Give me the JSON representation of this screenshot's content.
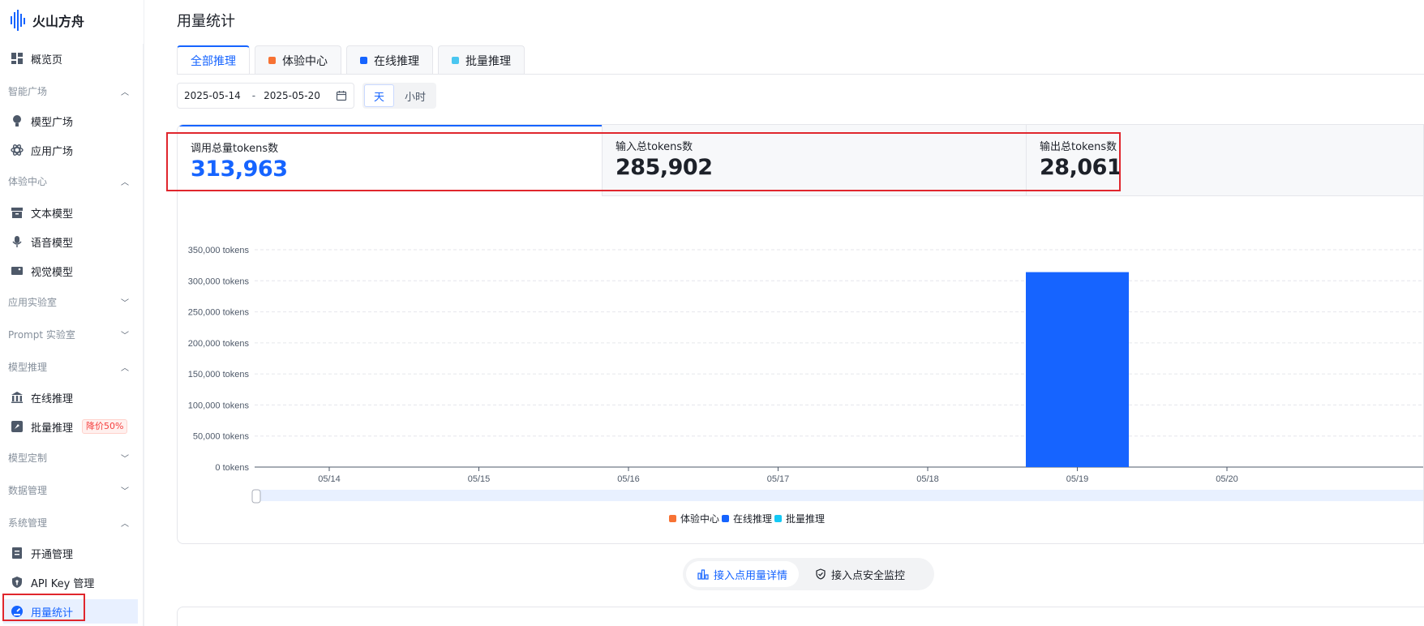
{
  "app": {
    "name": "火山方舟"
  },
  "sidebar": {
    "overview": "概览页",
    "groups": [
      {
        "title": "智能广场",
        "chevron": "up",
        "items": [
          "模型广场",
          "应用广场"
        ]
      },
      {
        "title": "体验中心",
        "chevron": "up",
        "items": [
          "文本模型",
          "语音模型",
          "视觉模型"
        ]
      },
      {
        "title": "应用实验室",
        "chevron": "down",
        "items": []
      },
      {
        "title": "Prompt 实验室",
        "chevron": "down",
        "items": []
      },
      {
        "title": "模型推理",
        "chevron": "up",
        "items": [
          "在线推理",
          "批量推理"
        ]
      },
      {
        "title": "模型定制",
        "chevron": "down",
        "items": []
      },
      {
        "title": "数据管理",
        "chevron": "down",
        "items": []
      },
      {
        "title": "系统管理",
        "chevron": "up",
        "items": [
          "开通管理",
          "API Key 管理",
          "用量统计"
        ]
      }
    ],
    "batch_badge": "降价50%"
  },
  "page": {
    "title": "用量统计",
    "tabs": [
      {
        "label": "全部推理",
        "color": null,
        "active": true
      },
      {
        "label": "体验中心",
        "color": "#f77234",
        "active": false
      },
      {
        "label": "在线推理",
        "color": "#1664ff",
        "active": false
      },
      {
        "label": "批量推理",
        "color": "#4ac6f0",
        "active": false
      }
    ],
    "date_start": "2025-05-14",
    "date_sep": "-",
    "date_end": "2025-05-20",
    "granularity": {
      "day": "天",
      "hour": "小时",
      "selected": "天"
    },
    "stats": [
      {
        "label": "调用总量tokens数",
        "value": "313,963"
      },
      {
        "label": "输入总tokens数",
        "value": "285,902"
      },
      {
        "label": "输出总tokens数",
        "value": "28,061"
      }
    ],
    "bottom_tabs": [
      {
        "label": "接入点用量详情",
        "active": true
      },
      {
        "label": "接入点安全监控",
        "active": false
      }
    ]
  },
  "chart_data": {
    "type": "bar",
    "categories": [
      "05/14",
      "05/15",
      "05/16",
      "05/17",
      "05/18",
      "05/19",
      "05/20"
    ],
    "series": [
      {
        "name": "体验中心",
        "color": "#f77234",
        "values": [
          0,
          0,
          0,
          0,
          0,
          0,
          0
        ]
      },
      {
        "name": "在线推理",
        "color": "#1664ff",
        "values": [
          0,
          0,
          0,
          0,
          0,
          313963,
          0
        ]
      },
      {
        "name": "批量推理",
        "color": "#14c9f5",
        "values": [
          0,
          0,
          0,
          0,
          0,
          0,
          0
        ]
      }
    ],
    "ylim": [
      0,
      350000
    ],
    "yticks": [
      0,
      50000,
      100000,
      150000,
      200000,
      250000,
      300000,
      350000
    ],
    "ytick_labels": [
      "0 tokens",
      "50,000 tokens",
      "100,000 tokens",
      "150,000 tokens",
      "200,000 tokens",
      "250,000 tokens",
      "300,000 tokens",
      "350,000 tokens"
    ],
    "grid": true,
    "legend_position": "bottom-center"
  }
}
